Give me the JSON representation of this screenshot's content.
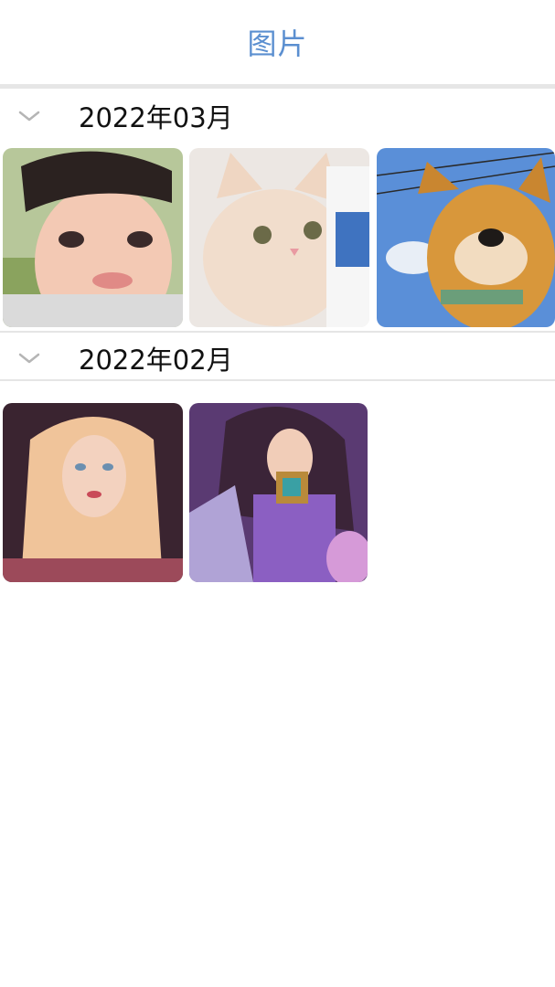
{
  "header": {
    "title": "图片"
  },
  "sections": [
    {
      "title": "2022年03月",
      "photos": [
        {
          "name": "photo-child-portrait"
        },
        {
          "name": "photo-white-cat"
        },
        {
          "name": "photo-shiba-dog"
        }
      ]
    },
    {
      "title": "2022年02月",
      "photos": [
        {
          "name": "photo-blonde-woman-illustration"
        },
        {
          "name": "photo-purple-warrior-illustration"
        }
      ]
    }
  ],
  "colors": {
    "accent": "#5b8fd0",
    "divider": "#e5e5e5",
    "chevron": "#b5b5b5"
  },
  "icons": {
    "collapse": "chevron-down-icon"
  }
}
